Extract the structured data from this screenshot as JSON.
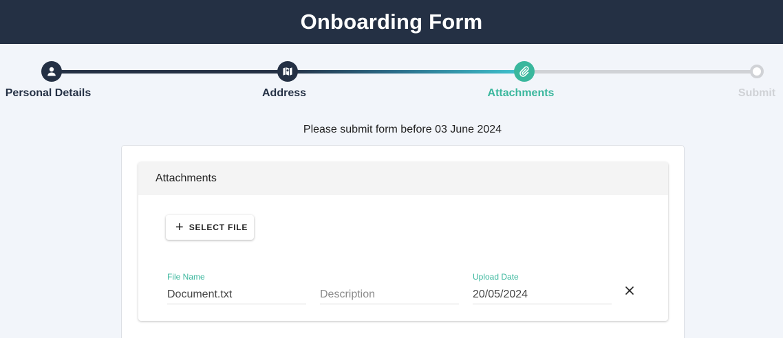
{
  "header": {
    "title": "Onboarding Form"
  },
  "stepper": {
    "steps": [
      {
        "label": "Personal Details",
        "state": "completed",
        "icon": "user-icon"
      },
      {
        "label": "Address",
        "state": "completed",
        "icon": "map-icon"
      },
      {
        "label": "Attachments",
        "state": "active",
        "icon": "paperclip-icon"
      },
      {
        "label": "Submit",
        "state": "pending",
        "icon": "ring-icon"
      }
    ]
  },
  "deadline_text": "Please submit form before 03 June 2024",
  "attachments_panel": {
    "title": "Attachments",
    "select_file_label": "SELECT FILE",
    "row": {
      "file_name_label": "File Name",
      "file_name_value": "Document.txt",
      "description_placeholder": "Description",
      "upload_date_label": "Upload Date",
      "upload_date_value": "20/05/2024"
    }
  },
  "colors": {
    "header_bg": "#243044",
    "accent_teal": "#3ab79d",
    "inactive_gray": "#d0d2d6",
    "page_bg": "#f2f5fa"
  }
}
